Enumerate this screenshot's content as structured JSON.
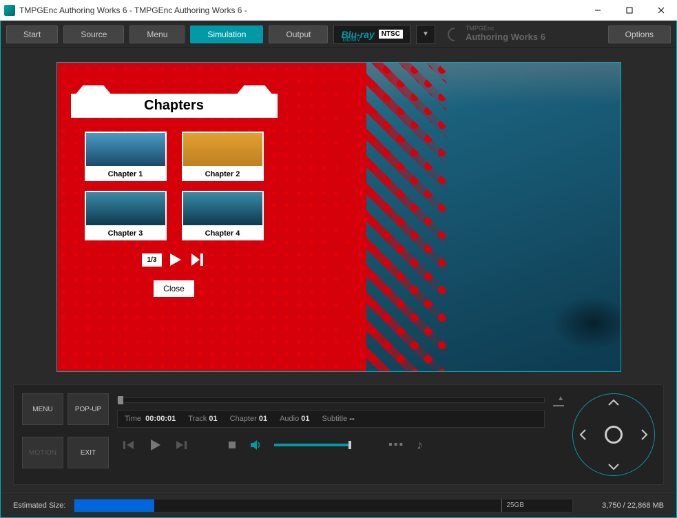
{
  "window": {
    "title": "TMPGEnc Authoring Works 6 - TMPGEnc Authoring Works 6 -"
  },
  "toolbar": {
    "start": "Start",
    "source": "Source",
    "menu": "Menu",
    "simulation": "Simulation",
    "output": "Output",
    "format_main": "Blu-ray",
    "format_sub": "BDMV",
    "format_region": "NTSC",
    "brand_line1": "TMPGEnc",
    "brand_line2": "Authoring Works 6",
    "options": "Options"
  },
  "menu_overlay": {
    "title": "Chapters",
    "chapters": [
      "Chapter 1",
      "Chapter 2",
      "Chapter 3",
      "Chapter 4"
    ],
    "pager": "1/3",
    "close": "Close"
  },
  "controls": {
    "menu": "MENU",
    "popup": "POP-UP",
    "motion": "MOTION",
    "exit": "EXIT",
    "info": {
      "time_label": "Time",
      "time_value": "00:00:01",
      "track_label": "Track",
      "track_value": "01",
      "chapter_label": "Chapter",
      "chapter_value": "01",
      "audio_label": "Audio",
      "audio_value": "01",
      "subtitle_label": "Subtitle",
      "subtitle_value": "--"
    }
  },
  "status": {
    "label": "Estimated Size:",
    "marker": "25GB",
    "size_text": "3,750 / 22,868 MB"
  }
}
